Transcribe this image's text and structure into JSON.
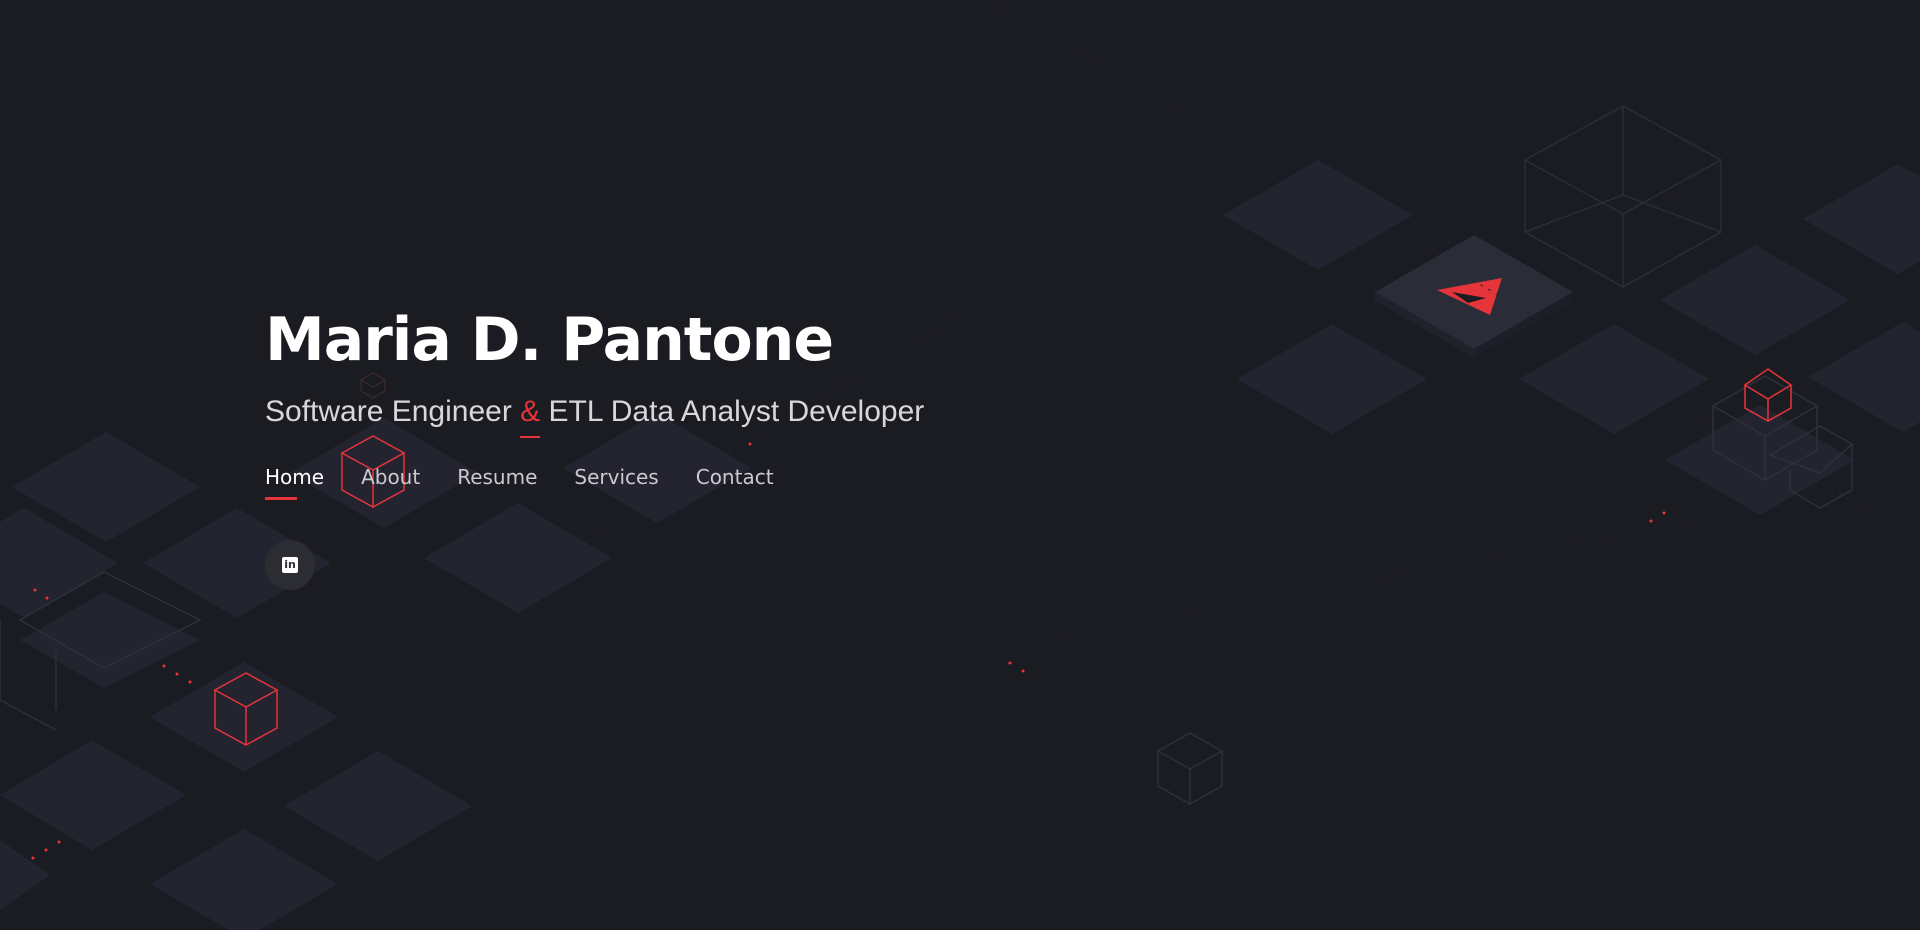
{
  "hero": {
    "name": "Maria D. Pantone",
    "tagline_part1": "Software Engineer ",
    "tagline_amp": "&",
    "tagline_part2": " ETL Data Analyst Developer"
  },
  "nav": {
    "items": [
      {
        "label": "Home",
        "active": true
      },
      {
        "label": "About",
        "active": false
      },
      {
        "label": "Resume",
        "active": false
      },
      {
        "label": "Services",
        "active": false
      },
      {
        "label": "Contact",
        "active": false
      }
    ]
  },
  "social": {
    "linkedin_glyph": "in",
    "icon": "linkedin-icon"
  },
  "colors": {
    "background": "#1b1c22",
    "tile": "#23242f",
    "accent": "#e5343a",
    "text": "#ffffff",
    "muted_text": "#d7d7dc"
  },
  "background_icons": [
    "cube-outline-icon",
    "paper-plane-icon",
    "isometric-tile"
  ]
}
